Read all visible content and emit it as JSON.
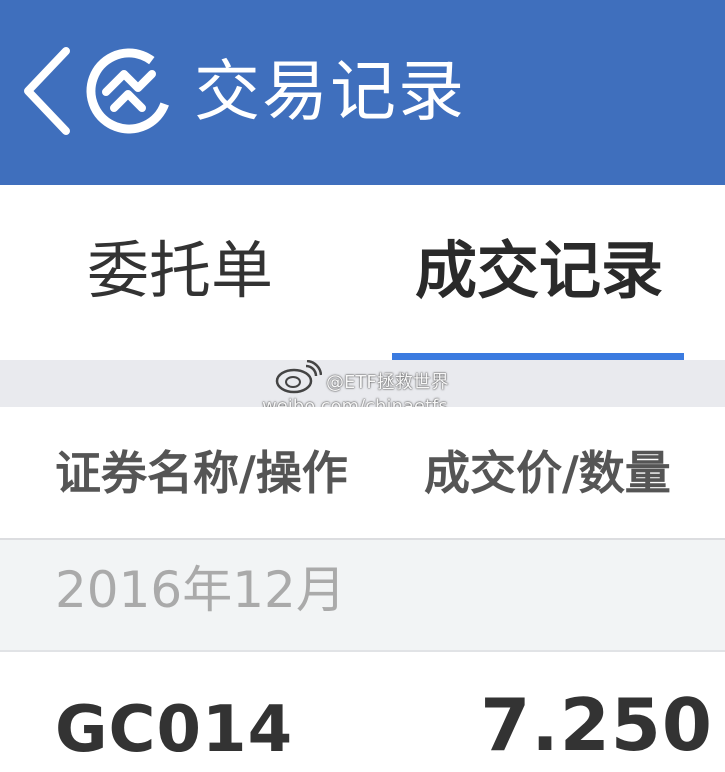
{
  "header": {
    "title": "交易记录",
    "back_icon": "chevron-left-icon",
    "logo_icon": "app-logo-icon"
  },
  "tabs": [
    {
      "label": "委托单",
      "active": false
    },
    {
      "label": "成交记录",
      "active": true
    }
  ],
  "watermark": {
    "handle": "@ETF拯救世界",
    "url": "weibo.com/chinaetfs"
  },
  "columns": {
    "name_op": "证券名称/操作",
    "price_qty": "成交价/数量"
  },
  "groups": [
    {
      "month": "2016年12月",
      "records": [
        {
          "code": "GC014",
          "price": "7.250"
        }
      ]
    }
  ],
  "colors": {
    "header_bg": "#3f6fbd",
    "tab_indicator": "#3b7be0",
    "section_bg": "#f2f4f5"
  }
}
